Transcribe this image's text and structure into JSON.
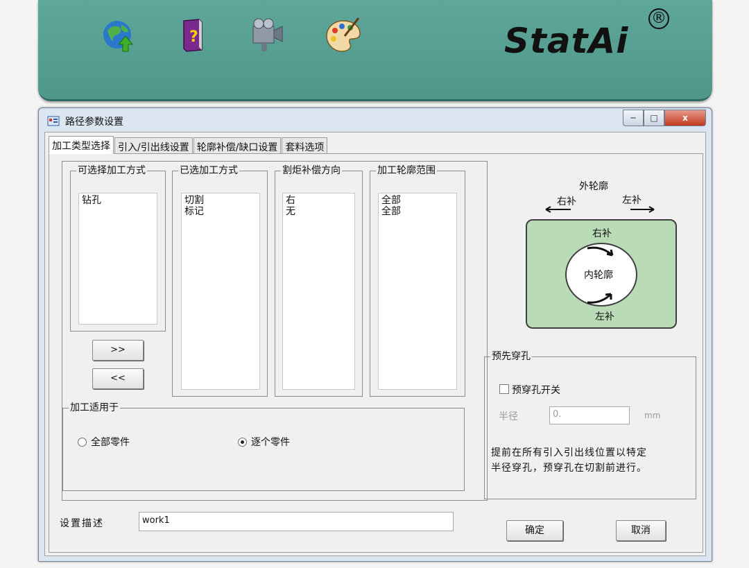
{
  "banner": {
    "icons": [
      "globe-upload-icon",
      "help-book-icon",
      "video-camera-icon",
      "palette-icon"
    ],
    "logo_text": "StatAi",
    "registered_mark": "®"
  },
  "window": {
    "title": "路径参数设置",
    "buttons": {
      "minimize": "─",
      "maximize": "□",
      "close": "x"
    }
  },
  "tabs": [
    "加工类型选择",
    "引入/引出线设置",
    "轮廓补偿/缺口设置",
    "套料选项"
  ],
  "groups": {
    "available": {
      "label": "可选择加工方式",
      "items": [
        "钻孔"
      ]
    },
    "selected": {
      "label": "已选加工方式",
      "items": [
        "切割",
        "标记"
      ]
    },
    "kerf": {
      "label": "割炬补偿方向",
      "items": [
        "右",
        "无"
      ]
    },
    "range": {
      "label": "加工轮廓范围",
      "items": [
        "全部",
        "全部"
      ]
    }
  },
  "move_buttons": {
    "add": ">>",
    "remove": "<<"
  },
  "apply_to": {
    "label": "加工适用于",
    "options": [
      "全部零件",
      "逐个零件"
    ],
    "selected_index": 1
  },
  "diagram": {
    "outer_label": "外轮廓",
    "outer_right": "右补",
    "outer_left": "左补",
    "inner_top": "右补",
    "inner_label": "内轮廓",
    "inner_bottom": "左补",
    "fill_color": "#b9dcb6"
  },
  "pierce": {
    "label": "预先穿孔",
    "switch_label": "预穿孔开关",
    "switch_checked": false,
    "radius_label": "半径",
    "radius_value": "0.",
    "unit": "mm",
    "note_line1": "提前在所有引入引出线位置以特定",
    "note_line2": "半径穿孔，预穿孔在切割前进行。"
  },
  "description": {
    "label": "设置描述",
    "value": "work1"
  },
  "ok_label": "确定",
  "cancel_label": "取消"
}
